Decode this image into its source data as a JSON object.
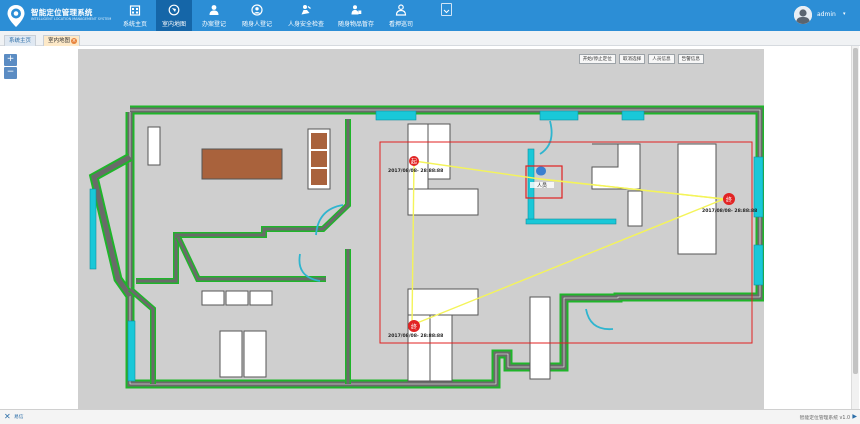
{
  "app": {
    "title": "智能定位管理系统",
    "subtitle": "INTELLIGENT LOCATION MANAGEMENT SYSTEM",
    "user": "admin"
  },
  "nav": {
    "items": [
      {
        "label": "系统主页",
        "icon": "home-icon",
        "active": false
      },
      {
        "label": "室内地图",
        "icon": "map-icon",
        "active": true
      },
      {
        "label": "办案登记",
        "icon": "case-register-icon",
        "active": false
      },
      {
        "label": "随身人登记",
        "icon": "person-register-icon",
        "active": false
      },
      {
        "label": "人身安全检查",
        "icon": "security-check-icon",
        "active": false
      },
      {
        "label": "随身物品暂存",
        "icon": "belongings-icon",
        "active": false
      },
      {
        "label": "看押巡司",
        "icon": "guard-icon",
        "active": false
      }
    ]
  },
  "tabs": [
    {
      "label": "系统主页"
    },
    {
      "label": "室内地图"
    }
  ],
  "zoom": {
    "in": "+",
    "out": "−"
  },
  "map_toolbar": [
    "开始/停止定位",
    "取消选择",
    "人员信息",
    "告警信息"
  ],
  "map": {
    "markers": [
      {
        "kind": "start",
        "glyph": "起",
        "timestamp": "2017/08/08- 28:88:88"
      },
      {
        "kind": "person",
        "glyph": "人员",
        "timestamp": ""
      },
      {
        "kind": "end",
        "glyph": "终",
        "timestamp": "2017/08/08- 28:88:88"
      },
      {
        "kind": "waypoint",
        "glyph": "终",
        "timestamp": "2017/08/08- 28:88:88"
      }
    ],
    "colors": {
      "wall_outer": "#1fb52a",
      "wall_inner": "#666666",
      "window": "#19c8d8",
      "path": "#f4f45a",
      "selection": "#e02020",
      "table": "#a9623c",
      "floor": "#cfcfcf"
    }
  },
  "footer": {
    "brand": "易信",
    "version": "智能定位管理系统 v1.0"
  }
}
